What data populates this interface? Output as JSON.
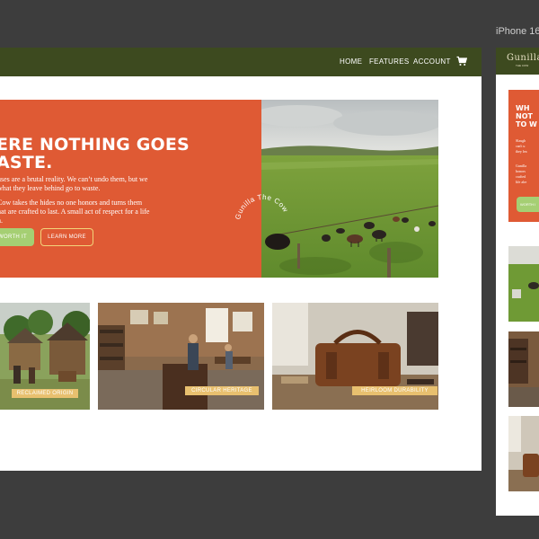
{
  "desktop": {
    "nav": {
      "links": [
        "HOME",
        "FEATURES",
        "ACCOUNT"
      ],
      "cart_icon": "cart-icon"
    },
    "hero": {
      "title": "ERE NOTHING GOES\nASTE.",
      "body1": "uses are a brutal reality. We can’t undo them, but we\nwhat they leave behind go to waste.",
      "body2": "Cow takes the hides no one honors and turns them\nhat are crafted to last. A small act of respect for a life\nh.",
      "button_primary": "WORTH IT",
      "button_secondary": "LEARN MORE",
      "badge_text": "Gunilla The Cow"
    },
    "cards": [
      {
        "label": "RECLAIMED ORIGIN"
      },
      {
        "label": "CIRCULAR HERITAGE"
      },
      {
        "label": "HEIRLOOM DURABILITY"
      }
    ]
  },
  "phone": {
    "frame_title": "iPhone 16",
    "logo": "Gunilla",
    "logo_sub": "THE COW",
    "hero_title": "WH\nNOT\nTO W",
    "hero_body1": "Slaugh\ncan't u\nthey lea",
    "hero_body2": "Gunilla\nhonors\ncrafted\nlife alre",
    "button": "WORTH I"
  },
  "colors": {
    "nav": "#3d4a1f",
    "hero_orange": "#df5a34",
    "button_green": "#a5cf73",
    "label_gold": "#e8c06f",
    "background": "#3d3d3d"
  }
}
